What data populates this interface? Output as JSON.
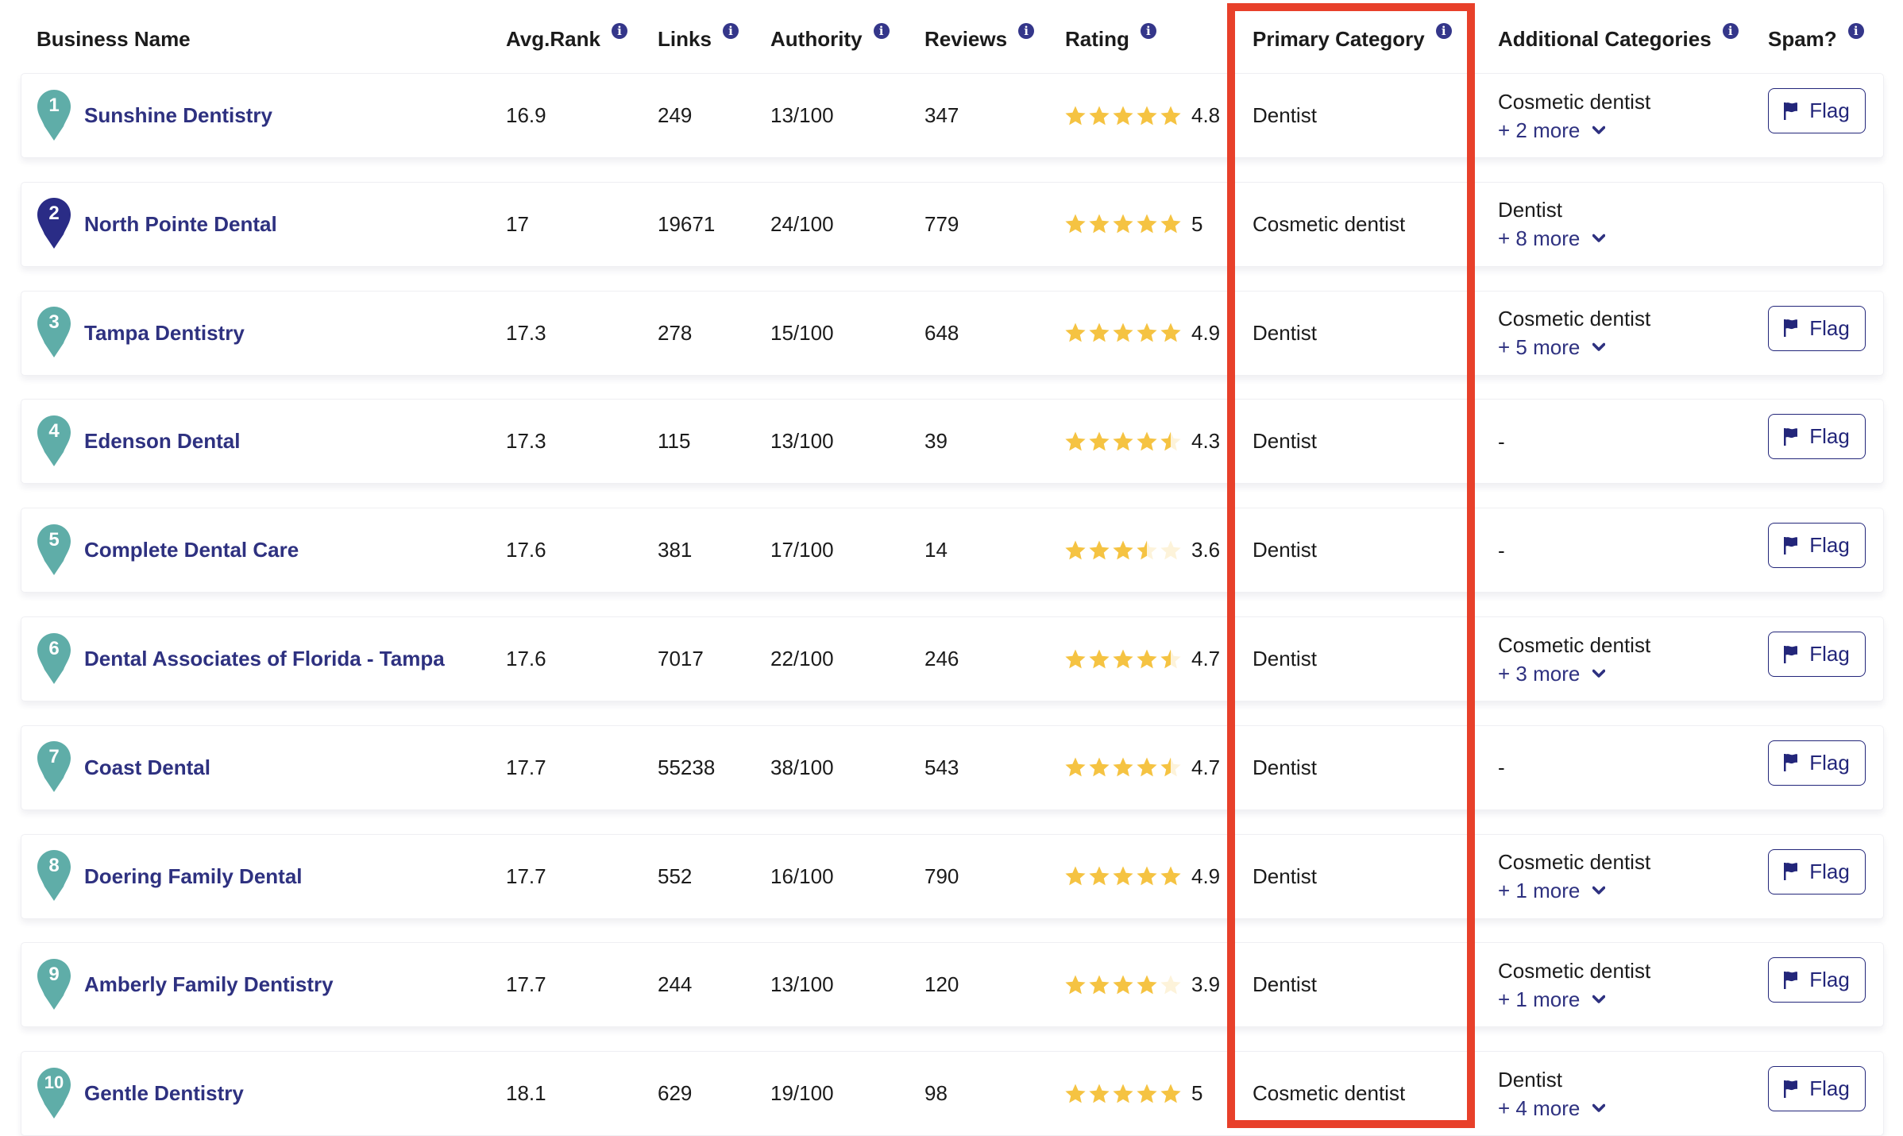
{
  "colors": {
    "accent": "#2E3180",
    "pin_default": "#5FADA8",
    "pin_selected": "#2A2C86",
    "star_filled": "#F5C342",
    "star_empty": "#FDF3DA",
    "highlight": "#E8402A",
    "info_icon": "#34368A"
  },
  "headers": {
    "business_name": "Business Name",
    "avg_rank": "Avg.Rank",
    "links": "Links",
    "authority": "Authority",
    "reviews": "Reviews",
    "rating": "Rating",
    "primary_category": "Primary Category",
    "additional_categories": "Additional Categories",
    "spam": "Spam?",
    "info_icon": "i"
  },
  "flag_label": "Flag",
  "highlighted_column": "Primary Category",
  "rows": [
    {
      "rank": "1",
      "name": "Sunshine Dentistry",
      "avg_rank": "16.9",
      "links": "249",
      "authority": "13/100",
      "reviews": "347",
      "rating": 4.8,
      "rating_label": "4.8",
      "primary": "Dentist",
      "additional_first": "Cosmetic dentist",
      "additional_more": "+ 2 more",
      "flag": true,
      "selected": false
    },
    {
      "rank": "2",
      "name": "North Pointe Dental",
      "avg_rank": "17",
      "links": "19671",
      "authority": "24/100",
      "reviews": "779",
      "rating": 5,
      "rating_label": "5",
      "primary": "Cosmetic dentist",
      "additional_first": "Dentist",
      "additional_more": "+ 8 more",
      "flag": false,
      "selected": true
    },
    {
      "rank": "3",
      "name": "Tampa Dentistry",
      "avg_rank": "17.3",
      "links": "278",
      "authority": "15/100",
      "reviews": "648",
      "rating": 4.9,
      "rating_label": "4.9",
      "primary": "Dentist",
      "additional_first": "Cosmetic dentist",
      "additional_more": "+ 5 more",
      "flag": true,
      "selected": false
    },
    {
      "rank": "4",
      "name": "Edenson Dental",
      "avg_rank": "17.3",
      "links": "115",
      "authority": "13/100",
      "reviews": "39",
      "rating": 4.3,
      "rating_label": "4.3",
      "primary": "Dentist",
      "additional_first": "-",
      "additional_more": null,
      "flag": true,
      "selected": false
    },
    {
      "rank": "5",
      "name": "Complete Dental Care",
      "avg_rank": "17.6",
      "links": "381",
      "authority": "17/100",
      "reviews": "14",
      "rating": 3.6,
      "rating_label": "3.6",
      "primary": "Dentist",
      "additional_first": "-",
      "additional_more": null,
      "flag": true,
      "selected": false
    },
    {
      "rank": "6",
      "name": "Dental Associates of Florida - Tampa",
      "avg_rank": "17.6",
      "links": "7017",
      "authority": "22/100",
      "reviews": "246",
      "rating": 4.7,
      "rating_label": "4.7",
      "primary": "Dentist",
      "additional_first": "Cosmetic dentist",
      "additional_more": "+ 3 more",
      "flag": true,
      "selected": false
    },
    {
      "rank": "7",
      "name": "Coast Dental",
      "avg_rank": "17.7",
      "links": "55238",
      "authority": "38/100",
      "reviews": "543",
      "rating": 4.7,
      "rating_label": "4.7",
      "primary": "Dentist",
      "additional_first": "-",
      "additional_more": null,
      "flag": true,
      "selected": false
    },
    {
      "rank": "8",
      "name": "Doering Family Dental",
      "avg_rank": "17.7",
      "links": "552",
      "authority": "16/100",
      "reviews": "790",
      "rating": 4.9,
      "rating_label": "4.9",
      "primary": "Dentist",
      "additional_first": "Cosmetic dentist",
      "additional_more": "+ 1 more",
      "flag": true,
      "selected": false
    },
    {
      "rank": "9",
      "name": "Amberly Family Dentistry",
      "avg_rank": "17.7",
      "links": "244",
      "authority": "13/100",
      "reviews": "120",
      "rating": 3.9,
      "rating_label": "3.9",
      "primary": "Dentist",
      "additional_first": "Cosmetic dentist",
      "additional_more": "+ 1 more",
      "flag": true,
      "selected": false
    },
    {
      "rank": "10",
      "name": "Gentle Dentistry",
      "avg_rank": "18.1",
      "links": "629",
      "authority": "19/100",
      "reviews": "98",
      "rating": 5,
      "rating_label": "5",
      "primary": "Cosmetic dentist",
      "additional_first": "Dentist",
      "additional_more": "+ 4 more",
      "flag": true,
      "selected": false
    }
  ]
}
